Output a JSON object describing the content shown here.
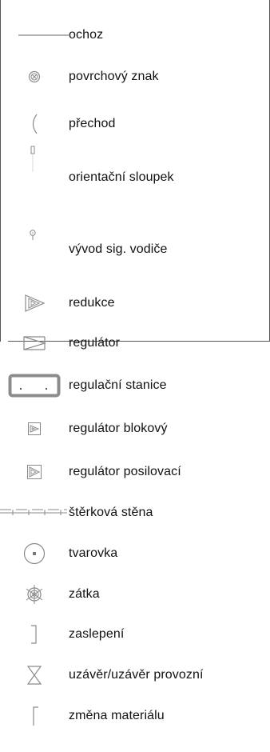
{
  "legend": {
    "items": [
      {
        "name": "ochoz-line-icon",
        "label": "ochoz"
      },
      {
        "name": "povrchovy-znak-icon",
        "label": "povrchový znak"
      },
      {
        "name": "prechod-arc-icon",
        "label": "přechod"
      },
      {
        "name": "orientacni-sloupek-icon",
        "label": "orientační sloupek"
      },
      {
        "name": "vyvod-sig-vodice-icon",
        "label": "vývod sig. vodiče"
      },
      {
        "name": "redukce-icon",
        "label": "redukce"
      },
      {
        "name": "regulator-icon",
        "label": "regulátor"
      },
      {
        "name": "regulacni-stanice-icon",
        "label": "regulační stanice"
      },
      {
        "name": "regulator-blokovy-icon",
        "label": "regulátor blokový"
      },
      {
        "name": "regulator-posilovaci-icon",
        "label": "regulátor posilovací"
      },
      {
        "name": "sterkova-stena-icon",
        "label": "štěrková stěna"
      },
      {
        "name": "tvarovka-icon",
        "label": "tvarovka"
      },
      {
        "name": "zatka-icon",
        "label": "zátka"
      },
      {
        "name": "zaslepeni-icon",
        "label": "zaslepení"
      },
      {
        "name": "uzaver-icon",
        "label": "uzávěr/uzávěr provozní"
      },
      {
        "name": "zmena-materialu-icon",
        "label": "změna materiálu"
      }
    ]
  },
  "colors": {
    "symbol_stroke": "#8a8a8a",
    "symbol_stroke_dark": "#555555",
    "station_fill": "#8c8c8c",
    "frame": "#555555"
  }
}
